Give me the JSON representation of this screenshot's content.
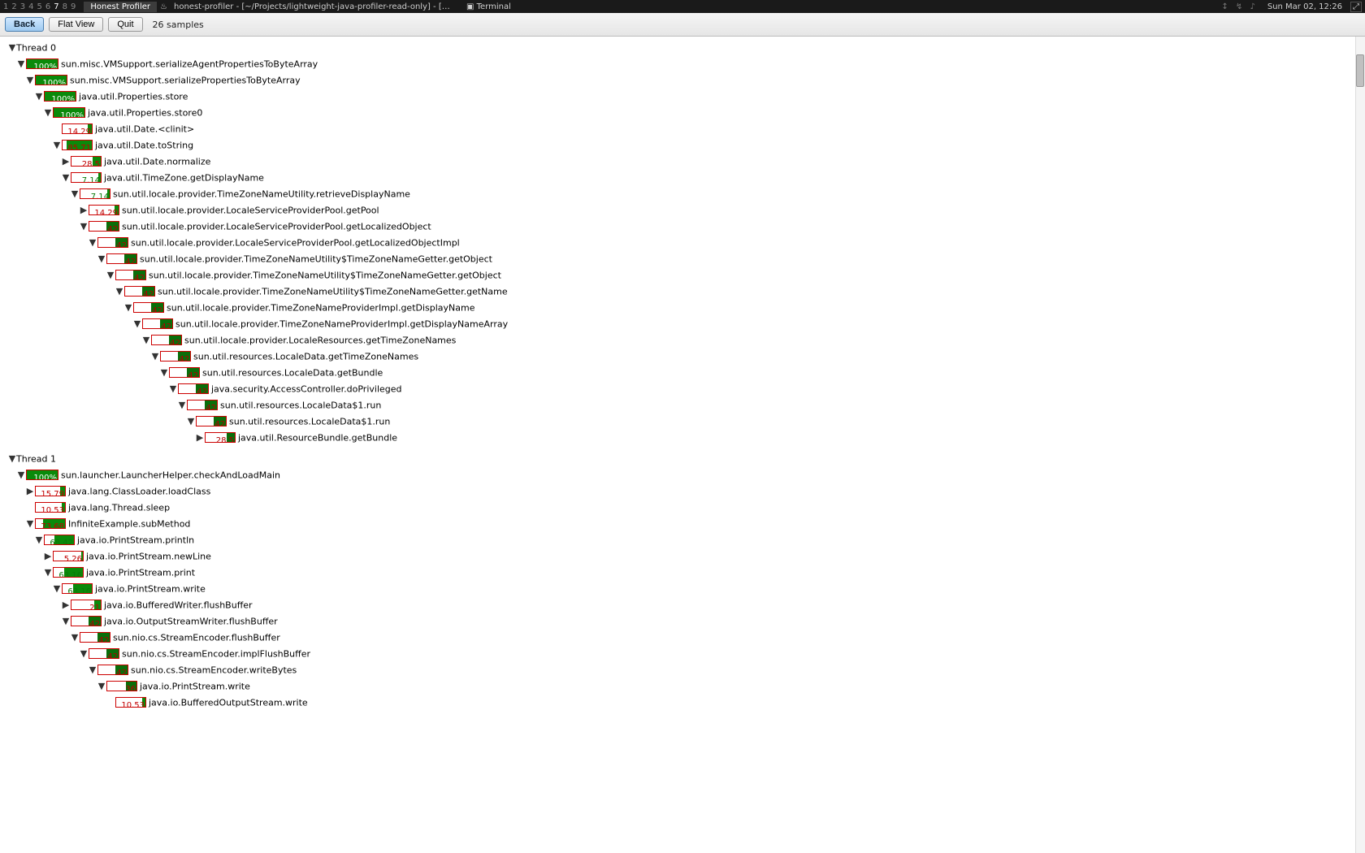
{
  "topbar": {
    "workspaces": [
      "1",
      "2",
      "3",
      "4",
      "5",
      "6",
      "7",
      "8",
      "9"
    ],
    "active_ws": 6,
    "app_active": "Honest Profiler",
    "app_other_icon": "♨",
    "app_other": "honest-profiler - [~/Projects/lightweight-java-profiler-read-only] - [honest-profi...",
    "terminal": "Terminal",
    "sys": "↕ ↯ ♪",
    "clock": "Sun Mar 02, 12:26",
    "expand": "⤢"
  },
  "toolbar": {
    "back": "Back",
    "flat": "Flat View",
    "quit": "Quit",
    "samples": "26 samples"
  },
  "tree": [
    {
      "d": 0,
      "t": "down",
      "label": "Thread 0",
      "pct": null
    },
    {
      "d": 1,
      "t": "down",
      "pct": 100,
      "full": true,
      "label": "sun.misc.VMSupport.serializeAgentPropertiesToByteArray"
    },
    {
      "d": 2,
      "t": "down",
      "pct": 100,
      "full": true,
      "label": "sun.misc.VMSupport.serializePropertiesToByteArray"
    },
    {
      "d": 3,
      "t": "down",
      "pct": 100,
      "full": true,
      "label": "java.util.Properties.store"
    },
    {
      "d": 4,
      "t": "down",
      "pct": 100,
      "full": true,
      "label": "java.util.Properties.store0"
    },
    {
      "d": 5,
      "t": "none",
      "pct": 14.29,
      "fill": 14,
      "label": "java.util.Date.<clinit>"
    },
    {
      "d": 5,
      "t": "down",
      "pct": 85.71,
      "fill": 86,
      "label": "java.util.Date.toString"
    },
    {
      "d": 6,
      "t": "right",
      "pct": 28.5,
      "fill": 29,
      "label": "java.util.Date.normalize"
    },
    {
      "d": 6,
      "t": "down",
      "pct": 7.14,
      "fill": 7,
      "green": true,
      "label": "java.util.TimeZone.getDisplayName"
    },
    {
      "d": 7,
      "t": "down",
      "pct": 7.14,
      "fill": 7,
      "green": true,
      "label": "sun.util.locale.provider.TimeZoneNameUtility.retrieveDisplayName"
    },
    {
      "d": 8,
      "t": "right",
      "pct": 14.29,
      "fill": 14,
      "label": "sun.util.locale.provider.LocaleServiceProviderPool.getPool"
    },
    {
      "d": 8,
      "t": "down",
      "pct": 42,
      "fill": 42,
      "dark": true,
      "label": "sun.util.locale.provider.LocaleServiceProviderPool.getLocalizedObject"
    },
    {
      "d": 9,
      "t": "down",
      "pct": 42,
      "fill": 42,
      "dark": true,
      "label": "sun.util.locale.provider.LocaleServiceProviderPool.getLocalizedObjectImpl"
    },
    {
      "d": 10,
      "t": "down",
      "pct": 42,
      "fill": 42,
      "dark": true,
      "label": "sun.util.locale.provider.TimeZoneNameUtility$TimeZoneNameGetter.getObject"
    },
    {
      "d": 11,
      "t": "down",
      "pct": 42,
      "fill": 42,
      "dark": true,
      "label": "sun.util.locale.provider.TimeZoneNameUtility$TimeZoneNameGetter.getObject"
    },
    {
      "d": 12,
      "t": "down",
      "pct": 42,
      "fill": 42,
      "dark": true,
      "label": "sun.util.locale.provider.TimeZoneNameUtility$TimeZoneNameGetter.getName"
    },
    {
      "d": 13,
      "t": "down",
      "pct": 42,
      "fill": 42,
      "dark": true,
      "label": "sun.util.locale.provider.TimeZoneNameProviderImpl.getDisplayName"
    },
    {
      "d": 14,
      "t": "down",
      "pct": 42,
      "fill": 42,
      "dark": true,
      "label": "sun.util.locale.provider.TimeZoneNameProviderImpl.getDisplayNameArray"
    },
    {
      "d": 15,
      "t": "down",
      "pct": 42,
      "fill": 42,
      "dark": true,
      "label": "sun.util.locale.provider.LocaleResources.getTimeZoneNames"
    },
    {
      "d": 16,
      "t": "down",
      "pct": 42,
      "fill": 42,
      "dark": true,
      "label": "sun.util.resources.LocaleData.getTimeZoneNames"
    },
    {
      "d": 17,
      "t": "down",
      "pct": 42,
      "fill": 42,
      "dark": true,
      "label": "sun.util.resources.LocaleData.getBundle"
    },
    {
      "d": 18,
      "t": "down",
      "pct": 42,
      "fill": 42,
      "dark": true,
      "label": "java.security.AccessController.doPrivileged"
    },
    {
      "d": 19,
      "t": "down",
      "pct": 42,
      "fill": 42,
      "dark": true,
      "label": "sun.util.resources.LocaleData$1.run"
    },
    {
      "d": 20,
      "t": "down",
      "pct": 42,
      "fill": 42,
      "dark": true,
      "label": "sun.util.resources.LocaleData$1.run"
    },
    {
      "d": 21,
      "t": "right",
      "pct": 28.5,
      "fill": 29,
      "dark": true,
      "label": "java.util.ResourceBundle.getBundle"
    },
    {
      "d": 0,
      "t": "down",
      "label": "Thread 1",
      "pct_top": true,
      "pct": null,
      "pad": true
    },
    {
      "d": 1,
      "t": "down",
      "pct": 100,
      "full": true,
      "label": "sun.launcher.LauncherHelper.checkAndLoadMain"
    },
    {
      "d": 2,
      "t": "right",
      "pct": 15.79,
      "fill": 16,
      "label": "java.lang.ClassLoader.loadClass"
    },
    {
      "d": 2,
      "t": "none",
      "pct": 10.53,
      "fill": 11,
      "label": "java.lang.Thread.sleep"
    },
    {
      "d": 2,
      "t": "down",
      "pct": 73.68,
      "fill": 74,
      "label": "InfiniteExample.subMethod"
    },
    {
      "d": 3,
      "t": "down",
      "pct": 68.42,
      "fill": 68,
      "green": true,
      "label": "java.io.PrintStream.println"
    },
    {
      "d": 4,
      "t": "right",
      "pct": 5.26,
      "fill": 5,
      "red": true,
      "label": "java.io.PrintStream.newLine"
    },
    {
      "d": 4,
      "t": "down",
      "pct": 63.16,
      "fill": 63,
      "green": true,
      "label": "java.io.PrintStream.print"
    },
    {
      "d": 5,
      "t": "down",
      "pct": 63.16,
      "fill": 63,
      "green": true,
      "label": "java.io.PrintStream.write"
    },
    {
      "d": 6,
      "t": "right",
      "pct": 21.0,
      "fill": 21,
      "red": true,
      "label": "java.io.BufferedWriter.flushBuffer"
    },
    {
      "d": 6,
      "t": "down",
      "pct": 42,
      "fill": 42,
      "dark": true,
      "label": "java.io.OutputStreamWriter.flushBuffer"
    },
    {
      "d": 7,
      "t": "down",
      "pct": 42,
      "fill": 42,
      "dark": true,
      "label": "sun.nio.cs.StreamEncoder.flushBuffer"
    },
    {
      "d": 8,
      "t": "down",
      "pct": 42,
      "fill": 42,
      "dark": true,
      "label": "sun.nio.cs.StreamEncoder.implFlushBuffer"
    },
    {
      "d": 9,
      "t": "down",
      "pct": 42,
      "fill": 42,
      "dark": true,
      "label": "sun.nio.cs.StreamEncoder.writeBytes"
    },
    {
      "d": 10,
      "t": "down",
      "pct": 36,
      "fill": 36,
      "dark": true,
      "red": true,
      "label": "java.io.PrintStream.write"
    },
    {
      "d": 11,
      "t": "none",
      "pct": 10.53,
      "fill": 11,
      "label": "java.io.BufferedOutputStream.write"
    }
  ]
}
